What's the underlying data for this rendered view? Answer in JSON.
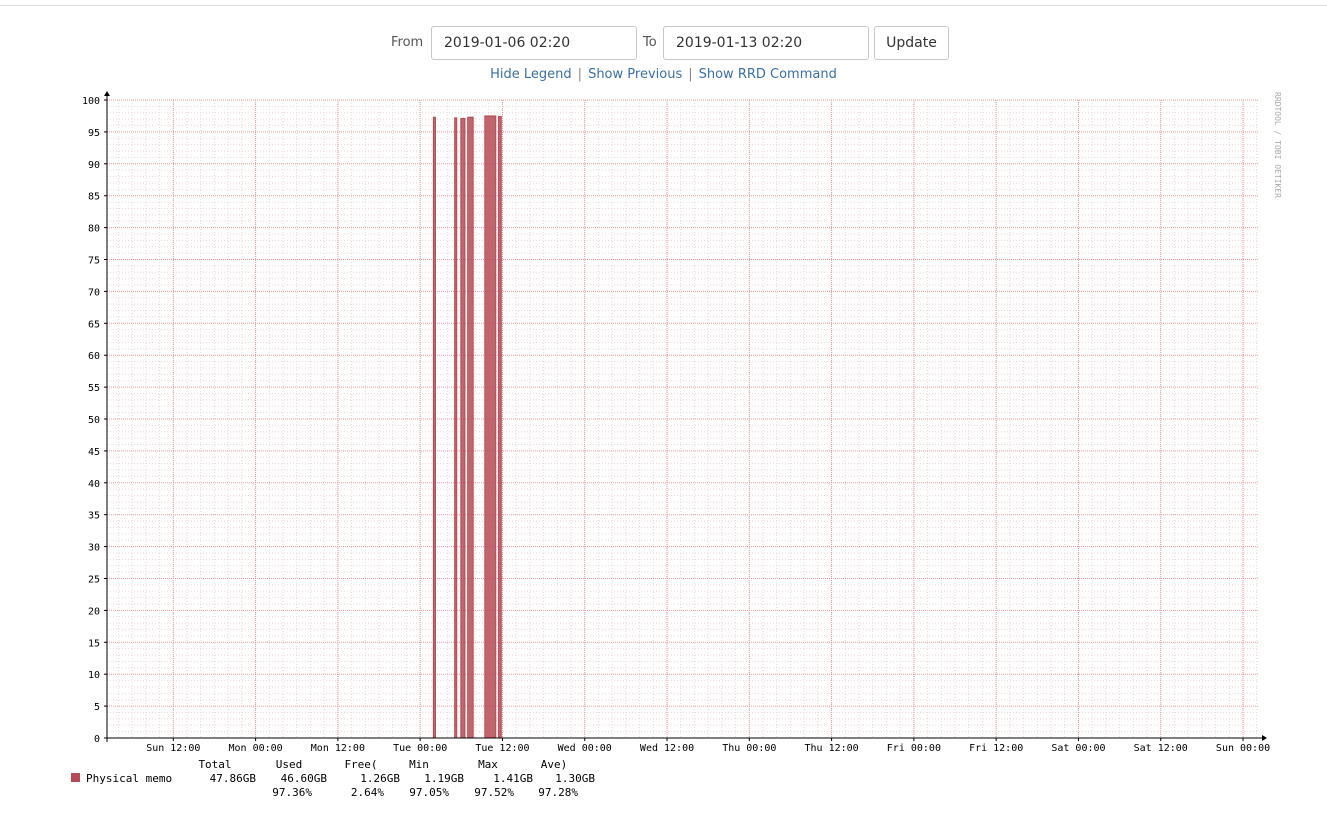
{
  "controls": {
    "from_label": "From",
    "from_value": "2019-01-06 02:20",
    "to_label": "To",
    "to_value": "2019-01-13 02:20",
    "update_label": "Update"
  },
  "links": {
    "hide_legend": "Hide Legend",
    "separator": "|",
    "show_previous": "Show Previous",
    "show_rrd_command": "Show RRD Command"
  },
  "chart_data": {
    "type": "area",
    "watermark": "RRDTOOL / TOBI OETIKER",
    "ylim": [
      0,
      100
    ],
    "y_ticks": [
      0,
      5,
      10,
      15,
      20,
      25,
      30,
      35,
      40,
      45,
      50,
      55,
      60,
      65,
      70,
      75,
      80,
      85,
      90,
      95,
      100
    ],
    "xlim": [
      0,
      168
    ],
    "x_ticks": [
      {
        "h": 9.67,
        "label": "Sun 12:00"
      },
      {
        "h": 21.67,
        "label": "Mon 00:00"
      },
      {
        "h": 33.67,
        "label": "Mon 12:00"
      },
      {
        "h": 45.67,
        "label": "Tue 00:00"
      },
      {
        "h": 57.67,
        "label": "Tue 12:00"
      },
      {
        "h": 69.67,
        "label": "Wed 00:00"
      },
      {
        "h": 81.67,
        "label": "Wed 12:00"
      },
      {
        "h": 93.67,
        "label": "Thu 00:00"
      },
      {
        "h": 105.67,
        "label": "Thu 12:00"
      },
      {
        "h": 117.67,
        "label": "Fri 00:00"
      },
      {
        "h": 129.67,
        "label": "Fri 12:00"
      },
      {
        "h": 141.67,
        "label": "Sat 00:00"
      },
      {
        "h": 153.67,
        "label": "Sat 12:00"
      },
      {
        "h": 165.67,
        "label": "Sun 00:00"
      }
    ],
    "series": [
      {
        "name": "Physical memo",
        "color": "#b84a52",
        "segments": [
          {
            "start": 47.6,
            "end": 47.9,
            "value": 97.3
          },
          {
            "start": 50.7,
            "end": 51.0,
            "value": 97.2
          },
          {
            "start": 51.6,
            "end": 52.2,
            "value": 97.1
          },
          {
            "start": 52.6,
            "end": 53.4,
            "value": 97.3
          },
          {
            "start": 55.1,
            "end": 56.7,
            "value": 97.5
          },
          {
            "start": 57.1,
            "end": 57.5,
            "value": 97.4
          }
        ]
      }
    ],
    "legend": {
      "headers": [
        "Total",
        "Used",
        "Free(",
        "Min",
        "Max",
        "Ave)"
      ],
      "row1": [
        "47.86GB",
        "46.60GB",
        "1.26GB",
        "1.19GB",
        "1.41GB",
        "1.30GB"
      ],
      "row2": [
        "97.36%",
        "2.64%",
        "97.05%",
        "97.52%",
        "97.28%"
      ]
    }
  }
}
